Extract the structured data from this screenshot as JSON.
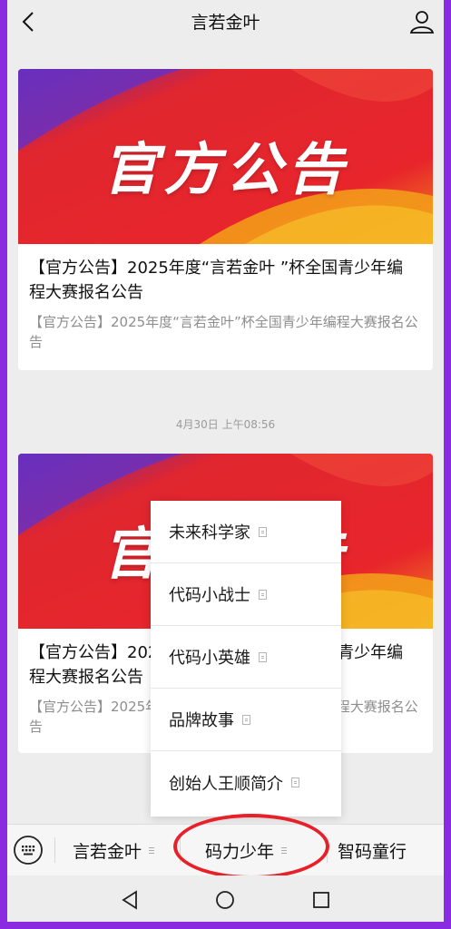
{
  "header": {
    "title": "言若金叶",
    "back_icon": "chevron-left-icon",
    "profile_icon": "person-icon"
  },
  "articles": [
    {
      "banner_text": "官方公告",
      "title": "【官方公告】2025年度“言若金叶 ”杯全国青少年编程大赛报名公告",
      "desc": "【官方公告】2025年度“言若金叶”杯全国青少年编程大赛报名公告"
    },
    {
      "banner_text": "官方公告",
      "title": "【官方公告】2025年度“言若金叶 ”杯全国青少年编程大赛报名公告",
      "desc": "【官方公告】2025年度“言若金叶”杯全国青少年编程大赛报名公告"
    }
  ],
  "timestamp": "4月30日 上午08:56",
  "popup_menu": {
    "items": [
      {
        "label": "未来科学家"
      },
      {
        "label": "代码小战士"
      },
      {
        "label": "代码小英雄"
      },
      {
        "label": "品牌故事"
      },
      {
        "label": "创始人王顺简介"
      }
    ]
  },
  "bottom_menu": {
    "keyboard_icon": "keyboard-icon",
    "items": [
      {
        "label": "言若金叶"
      },
      {
        "label": "码力少年"
      },
      {
        "label": "智码童行"
      }
    ]
  },
  "colors": {
    "banner_red": "#e8252b",
    "highlight_ring": "#e8202a",
    "border_purple": "#8a2be2"
  }
}
